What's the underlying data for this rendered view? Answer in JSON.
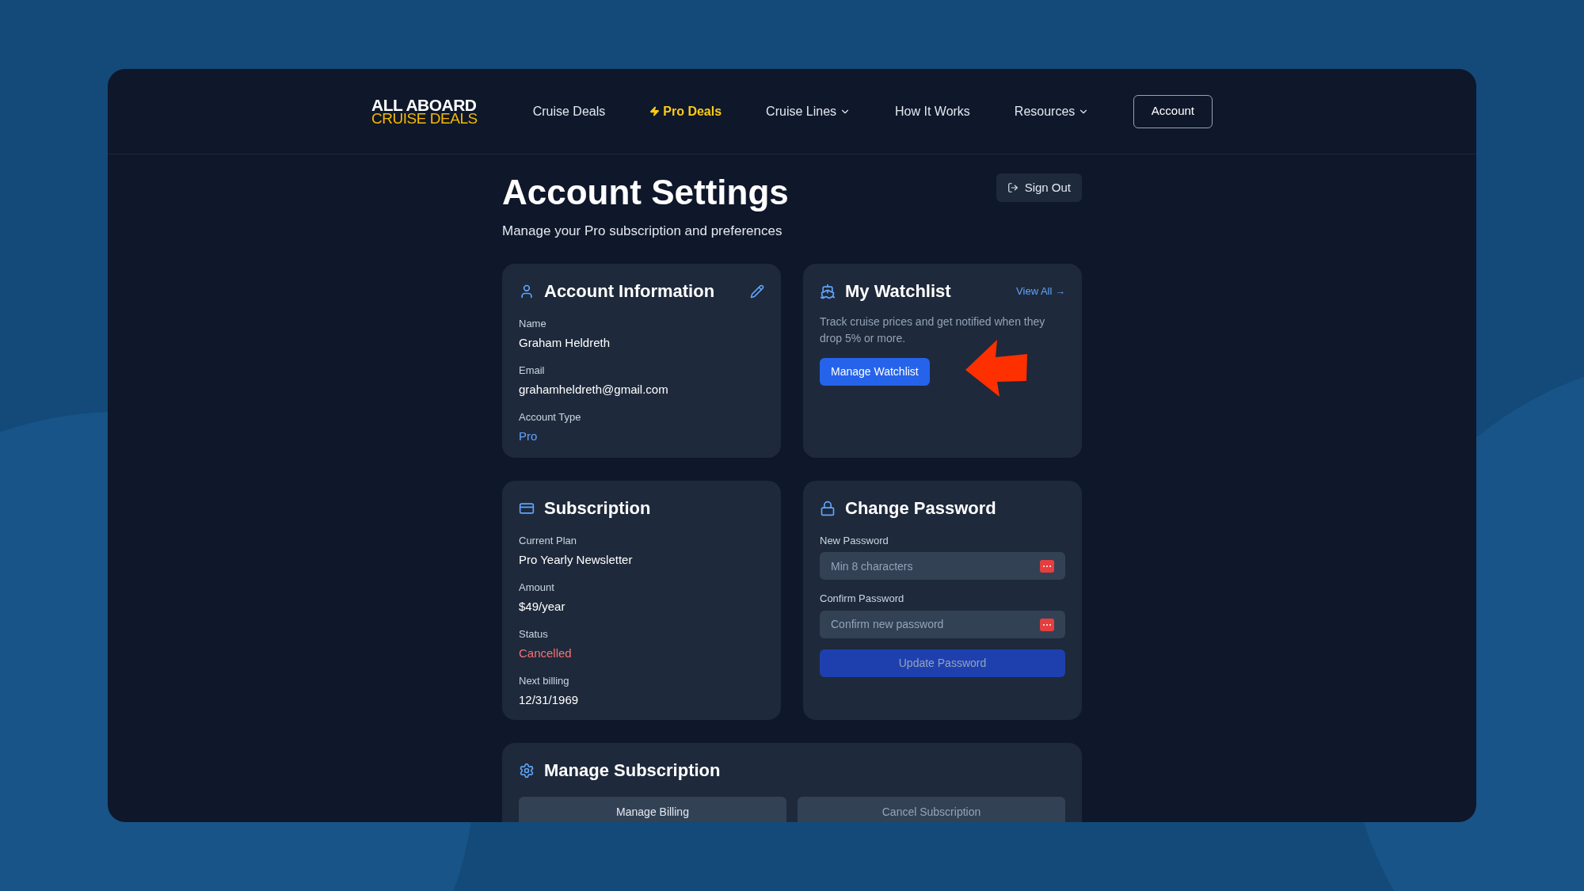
{
  "logo": {
    "line_1": "ALL ABOARD",
    "line_2": "CRUISE DEALS"
  },
  "nav": [
    {
      "label": "Cruise Deals",
      "selected": false,
      "dropdown": false
    },
    {
      "label": "Pro Deals",
      "selected": true,
      "dropdown": false
    },
    {
      "label": "Cruise Lines",
      "selected": false,
      "dropdown": true
    },
    {
      "label": "How It Works",
      "selected": false,
      "dropdown": false
    },
    {
      "label": "Resources",
      "selected": false,
      "dropdown": true
    }
  ],
  "account_button": "Account",
  "page": {
    "title": "Account Settings",
    "subtitle": "Manage your Pro subscription and preferences",
    "sign_out": "Sign Out"
  },
  "account_info": {
    "title": "Account Information",
    "fields": [
      {
        "label": "Name",
        "value": "Graham Heldreth",
        "kind": "plain"
      },
      {
        "label": "Email",
        "value": "grahamheldreth@gmail.com",
        "kind": "plain"
      },
      {
        "label": "Account Type",
        "value": "Pro",
        "kind": "accent"
      }
    ]
  },
  "watchlist": {
    "title": "My Watchlist",
    "link": "View All →",
    "description": "Track cruise prices and get notified when they drop 5% or more.",
    "button": "Manage Watchlist"
  },
  "subscription": {
    "title": "Subscription",
    "fields": [
      {
        "label": "Current Plan",
        "value": "Pro Yearly Newsletter",
        "kind": "plain"
      },
      {
        "label": "Amount",
        "value": "$49/year",
        "kind": "plain"
      },
      {
        "label": "Status",
        "value": "Cancelled",
        "kind": "danger"
      },
      {
        "label": "Next billing",
        "value": "12/31/1969",
        "kind": "plain"
      }
    ]
  },
  "change_password": {
    "title": "Change Password",
    "fields": [
      {
        "label": "New Password",
        "placeholder": "Min 8 characters"
      },
      {
        "label": "Confirm Password",
        "placeholder": "Confirm new password"
      }
    ],
    "button": {
      "label": "Update Password",
      "disabled": true
    }
  },
  "manage_subscription": {
    "title": "Manage Subscription",
    "buttons": [
      {
        "label": "Manage Billing",
        "disabled": false
      },
      {
        "label": "Cancel Subscription",
        "disabled": true
      }
    ]
  }
}
